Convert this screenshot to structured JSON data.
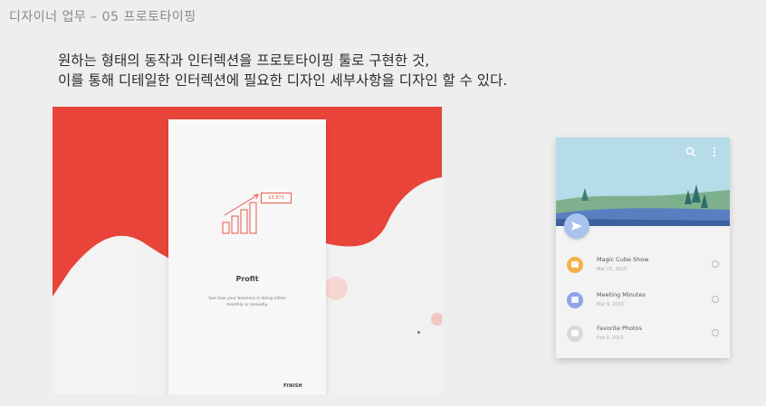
{
  "slide": {
    "header": "디자이너 업무 – 05 프로토타이핑",
    "headline_line1": "원하는 형태의 동작과 인터렉션을 프로토타이핑 툴로 구현한 것,",
    "headline_line2": "이를 통해 디테일한 인터렉션에 필요한 디자인 세부사항을 디자인 할 수 있다."
  },
  "onboarding_mock": {
    "amount_badge": "$3,873",
    "title": "Profit",
    "description": "See how your business is doing either monthly or annually.",
    "finish_label": "FINISH",
    "page_indicator": {
      "total": 3,
      "active": 3
    },
    "accent_color": "#e8443a"
  },
  "list_mock": {
    "hero_sky_color": "#b5dce8",
    "hero_ground_color": "#5a7fc0",
    "fab_icon": "send-icon",
    "items": [
      {
        "title": "Magic Cube Show",
        "date": "Mar 15, 2015",
        "icon_color": "#f2b24a"
      },
      {
        "title": "Meeting Minutes",
        "date": "Mar 9, 2015",
        "icon_color": "#8fa4e8"
      },
      {
        "title": "Favorite Photos",
        "date": "Feb 3, 2015",
        "icon_color": "#d9d9d9"
      }
    ]
  }
}
